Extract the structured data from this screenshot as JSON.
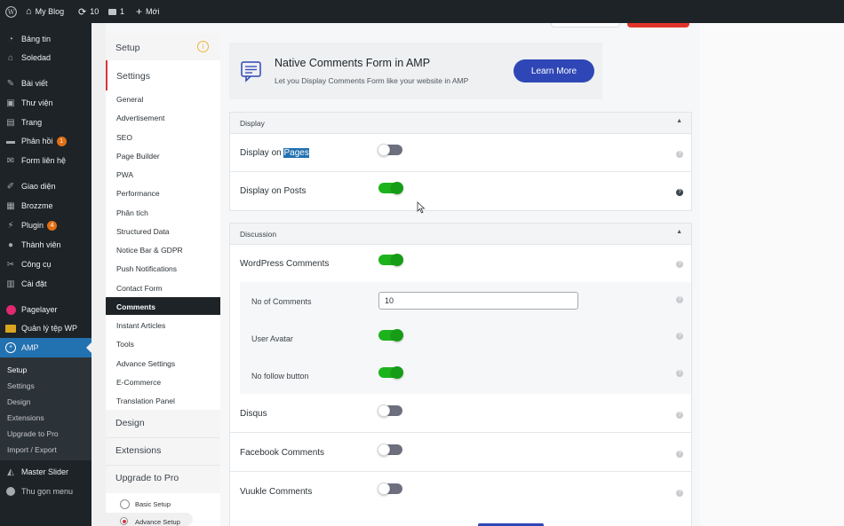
{
  "admin_bar": {
    "site_name": "My Blog",
    "updates": "10",
    "comments": "1",
    "new_label": "Mới"
  },
  "admin_menu": {
    "items": [
      {
        "label": "Bảng tin",
        "icon": "dashboard-icon"
      },
      {
        "label": "Soledad",
        "icon": "theme-icon"
      },
      {
        "label": "Bài viết",
        "icon": "pin-icon"
      },
      {
        "label": "Thư viện",
        "icon": "media-icon"
      },
      {
        "label": "Trang",
        "icon": "page-icon"
      },
      {
        "label": "Phản hồi",
        "icon": "comment-icon",
        "badge": "1"
      },
      {
        "label": "Form liên hệ",
        "icon": "mail-icon"
      },
      {
        "label": "Giao diện",
        "icon": "brush-icon"
      },
      {
        "label": "Brozzme",
        "icon": "grid-icon"
      },
      {
        "label": "Plugin",
        "icon": "plugin-icon",
        "badge": "4"
      },
      {
        "label": "Thành viên",
        "icon": "user-icon"
      },
      {
        "label": "Công cụ",
        "icon": "wrench-icon"
      },
      {
        "label": "Cài đặt",
        "icon": "settings-icon"
      },
      {
        "label": "Pagelayer",
        "icon": "pagelayer-icon"
      },
      {
        "label": "Quản lý tệp WP",
        "icon": "folder-icon"
      },
      {
        "label": "AMP",
        "icon": "amp-icon"
      }
    ],
    "amp_submenu": [
      "Setup",
      "Settings",
      "Design",
      "Extensions",
      "Upgrade to Pro",
      "Import / Export"
    ],
    "after_items": [
      {
        "label": "Master Slider",
        "icon": "slider-icon"
      },
      {
        "label": "Thu gọn menu",
        "icon": "collapse-icon"
      }
    ]
  },
  "settings_nav": {
    "setup": "Setup",
    "settings": "Settings",
    "items": [
      "General",
      "Advertisement",
      "SEO",
      "Page Builder",
      "PWA",
      "Performance",
      "Phân tích",
      "Structured Data",
      "Notice Bar & GDPR",
      "Push Notifications",
      "Contact Form",
      "Comments",
      "Instant Articles",
      "Tools",
      "Advance Settings",
      "E-Commerce",
      "Translation Panel"
    ],
    "design": "Design",
    "extensions": "Extensions",
    "upgrade": "Upgrade to Pro",
    "basic_setup": "Basic Setup",
    "advance_setup": "Advance Setup"
  },
  "banner": {
    "title": "Native Comments Form in AMP",
    "subtitle": "Let you Display Comments Form like your website in AMP",
    "button": "Learn More"
  },
  "display_section": {
    "title": "Display",
    "pages_label_prefix": "Display on",
    "pages_label_highlight": "Pages",
    "pages_on": false,
    "posts_label": "Display on Posts",
    "posts_on": true
  },
  "discussion_section": {
    "title": "Discussion",
    "wp_comments": "WordPress Comments",
    "no_of_comments_label": "No of Comments",
    "no_of_comments_value": "10",
    "user_avatar": "User Avatar",
    "no_follow": "No follow button",
    "disqus": "Disqus",
    "facebook": "Facebook Comments",
    "vuukle": "Vuukle Comments"
  },
  "colors": {
    "wp_dark": "#1d2327",
    "wp_blue": "#2271b1",
    "toggle_on": "#1db31d",
    "learn_more": "#2f47b6"
  }
}
